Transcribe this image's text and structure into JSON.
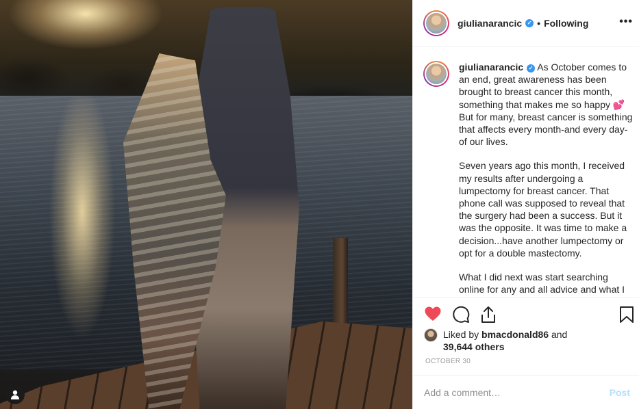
{
  "photo": {
    "alt": "",
    "badge_icon": "user-silhouette-icon"
  },
  "header": {
    "username": "giulianarancic",
    "verified_icon": "verified-badge-icon",
    "separator": "•",
    "follow_label": "Following",
    "more_icon": "ellipsis-icon"
  },
  "caption": {
    "username": "giulianarancic",
    "paragraphs": [
      "As October comes to an end, great awareness has been brought to breast cancer this month, something that makes me so happy",
      "But for many, breast cancer is something that affects every month-and every day-of our lives.",
      "Seven years ago this month, I received my results after undergoing a lumpectomy for breast cancer. That phone call was supposed to reveal that the surgery had been a success. But it was the opposite. It was time to make a decision...have another lumpectomy or opt for a double mastectomy.",
      "What I did next was start searching online for any and all advice and what I"
    ],
    "emoji": "💕"
  },
  "actions": {
    "like_icon": "heart-filled-icon",
    "comment_icon": "comment-bubble-icon",
    "share_icon": "share-icon",
    "save_icon": "bookmark-icon",
    "like_color": "#ed4956"
  },
  "likes": {
    "prefix": "Liked by",
    "liker": "bmacdonald86",
    "conjunction": "and",
    "others": "39,644 others"
  },
  "date": "OCTOBER 30",
  "comment_box": {
    "placeholder": "Add a comment…",
    "post_label": "Post",
    "post_color": "#b2dffc"
  },
  "colors": {
    "verified": "#3897f0",
    "divider": "#efefef",
    "muted": "#8e8e8e"
  }
}
